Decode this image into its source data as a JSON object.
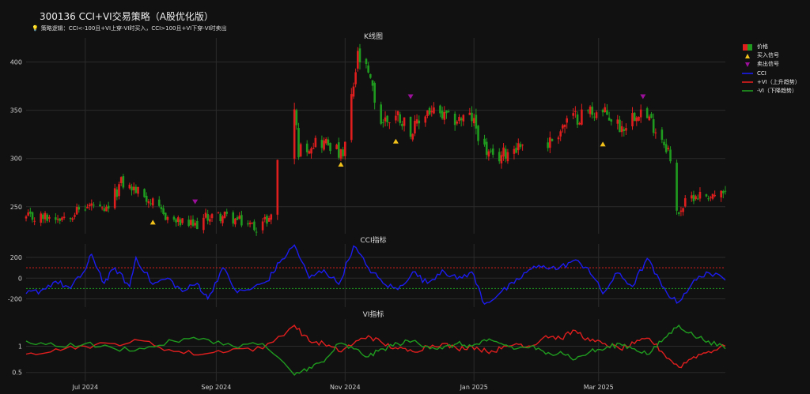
{
  "title": "300136 CCI+VI交易策略（A股优化版）",
  "subtitle": "策略逻辑：CCI<-100且+VI上穿-VI时买入，CCI>100且+VI下穿-VI时卖出",
  "colors": {
    "up": "#e01e1e",
    "down": "#1f9b1f",
    "buy": "#f2c21b",
    "sell": "#9b0f9b",
    "cci": "#1c1cf0",
    "vi_plus": "#e01e1e",
    "vi_minus": "#1f9b1f",
    "bg": "#111111",
    "grid": "#2b2b2b"
  },
  "panels": {
    "kline": "K线图",
    "cci": "CCI指标",
    "vi": "VI指标"
  },
  "legend": [
    {
      "label": "价格",
      "kind": "candle"
    },
    {
      "label": "买入信号",
      "kind": "buy"
    },
    {
      "label": "卖出信号",
      "kind": "sell"
    },
    {
      "label": "CCI",
      "kind": "cci"
    },
    {
      "label": "+VI（上升趋势）",
      "kind": "vi_plus"
    },
    {
      "label": "-VI（下降趋势）",
      "kind": "vi_minus"
    }
  ],
  "chart_data": [
    {
      "type": "candlestick",
      "title": "K线图",
      "x_start": "2024-06-03",
      "x_end": "2025-04-30",
      "x_ticks": [
        "Jul 2024",
        "Sep 2024",
        "Nov 2024",
        "Jan 2025",
        "Mar 2025"
      ],
      "y_ticks": [
        250,
        300,
        350,
        400
      ],
      "ylim": [
        222,
        425
      ],
      "close_keypoints": [
        [
          "2024-06-03",
          238
        ],
        [
          "2024-06-20",
          240
        ],
        [
          "2024-07-05",
          252
        ],
        [
          "2024-07-10",
          242
        ],
        [
          "2024-07-18",
          275
        ],
        [
          "2024-07-24",
          268
        ],
        [
          "2024-07-30",
          260
        ],
        [
          "2024-08-05",
          245
        ],
        [
          "2024-08-12",
          235
        ],
        [
          "2024-08-22",
          230
        ],
        [
          "2024-08-28",
          240
        ],
        [
          "2024-09-05",
          240
        ],
        [
          "2024-09-20",
          229
        ],
        [
          "2024-09-27",
          240
        ],
        [
          "2024-09-30",
          300
        ],
        [
          "2024-10-08",
          352
        ],
        [
          "2024-10-10",
          308
        ],
        [
          "2024-10-18",
          318
        ],
        [
          "2024-10-25",
          315
        ],
        [
          "2024-10-31",
          300
        ],
        [
          "2024-11-07",
          405
        ],
        [
          "2024-11-12",
          385
        ],
        [
          "2024-11-18",
          338
        ],
        [
          "2024-11-26",
          345
        ],
        [
          "2024-12-03",
          328
        ],
        [
          "2024-12-10",
          350
        ],
        [
          "2024-12-20",
          340
        ],
        [
          "2024-12-31",
          342
        ],
        [
          "2025-01-06",
          310
        ],
        [
          "2025-01-10",
          298
        ],
        [
          "2025-01-20",
          312
        ],
        [
          "2025-01-27",
          318
        ],
        [
          "2025-02-05",
          315
        ],
        [
          "2025-02-14",
          338
        ],
        [
          "2025-02-25",
          350
        ],
        [
          "2025-03-05",
          345
        ],
        [
          "2025-03-12",
          332
        ],
        [
          "2025-03-20",
          352
        ],
        [
          "2025-03-28",
          332
        ],
        [
          "2025-04-03",
          310
        ],
        [
          "2025-04-07",
          244
        ],
        [
          "2025-04-15",
          262
        ],
        [
          "2025-04-30",
          262
        ]
      ],
      "buy_signals": [
        [
          "2024-08-02",
          234
        ],
        [
          "2024-10-30",
          294
        ],
        [
          "2024-11-25",
          318
        ],
        [
          "2025-03-03",
          315
        ]
      ],
      "sell_signals": [
        [
          "2024-08-22",
          255
        ],
        [
          "2024-12-02",
          364
        ],
        [
          "2025-03-22",
          364
        ]
      ]
    },
    {
      "type": "line",
      "title": "CCI指标",
      "y_ticks": [
        -200,
        0,
        200
      ],
      "ylim": [
        -280,
        330
      ],
      "thresholds": [
        100,
        -100
      ],
      "series": [
        {
          "name": "CCI",
          "points": [
            [
              "2024-06-03",
              -150
            ],
            [
              "2024-06-10",
              -120
            ],
            [
              "2024-06-17",
              -30
            ],
            [
              "2024-06-24",
              -100
            ],
            [
              "2024-07-01",
              80
            ],
            [
              "2024-07-04",
              230
            ],
            [
              "2024-07-10",
              -50
            ],
            [
              "2024-07-15",
              100
            ],
            [
              "2024-07-22",
              -80
            ],
            [
              "2024-07-25",
              200
            ],
            [
              "2024-08-02",
              -60
            ],
            [
              "2024-08-09",
              0
            ],
            [
              "2024-08-16",
              -130
            ],
            [
              "2024-08-23",
              -50
            ],
            [
              "2024-08-28",
              -200
            ],
            [
              "2024-09-04",
              100
            ],
            [
              "2024-09-11",
              -140
            ],
            [
              "2024-09-18",
              -100
            ],
            [
              "2024-09-25",
              -30
            ],
            [
              "2024-10-01",
              150
            ],
            [
              "2024-10-08",
              320
            ],
            [
              "2024-10-15",
              0
            ],
            [
              "2024-10-22",
              80
            ],
            [
              "2024-10-29",
              -60
            ],
            [
              "2024-11-05",
              310
            ],
            [
              "2024-11-12",
              100
            ],
            [
              "2024-11-19",
              -50
            ],
            [
              "2024-11-26",
              -110
            ],
            [
              "2024-12-03",
              60
            ],
            [
              "2024-12-10",
              -50
            ],
            [
              "2024-12-17",
              80
            ],
            [
              "2024-12-24",
              -10
            ],
            [
              "2024-12-31",
              60
            ],
            [
              "2025-01-06",
              -250
            ],
            [
              "2025-01-13",
              -150
            ],
            [
              "2025-01-20",
              -50
            ],
            [
              "2025-01-27",
              80
            ],
            [
              "2025-02-03",
              120
            ],
            [
              "2025-02-10",
              90
            ],
            [
              "2025-02-17",
              170
            ],
            [
              "2025-02-24",
              100
            ],
            [
              "2025-03-03",
              -150
            ],
            [
              "2025-03-10",
              50
            ],
            [
              "2025-03-17",
              -80
            ],
            [
              "2025-03-24",
              190
            ],
            [
              "2025-03-31",
              -80
            ],
            [
              "2025-04-07",
              -240
            ],
            [
              "2025-04-14",
              -60
            ],
            [
              "2025-04-21",
              60
            ],
            [
              "2025-04-30",
              -20
            ]
          ]
        }
      ]
    },
    {
      "type": "line",
      "title": "VI指标",
      "y_ticks": [
        0.5,
        1
      ],
      "ylim": [
        0.33,
        1.52
      ],
      "series": [
        {
          "name": "+VI（上升趋势）",
          "points": [
            [
              "2024-06-03",
              0.85
            ],
            [
              "2024-06-17",
              0.95
            ],
            [
              "2024-07-01",
              1.0
            ],
            [
              "2024-07-15",
              1.05
            ],
            [
              "2024-07-29",
              1.1
            ],
            [
              "2024-08-12",
              0.9
            ],
            [
              "2024-08-26",
              0.85
            ],
            [
              "2024-09-09",
              0.95
            ],
            [
              "2024-09-23",
              0.95
            ],
            [
              "2024-10-08",
              1.4
            ],
            [
              "2024-10-15",
              1.1
            ],
            [
              "2024-10-22",
              1.05
            ],
            [
              "2024-10-29",
              0.9
            ],
            [
              "2024-11-05",
              1.05
            ],
            [
              "2024-11-12",
              1.2
            ],
            [
              "2024-11-19",
              1.05
            ],
            [
              "2024-11-26",
              0.95
            ],
            [
              "2024-12-03",
              0.9
            ],
            [
              "2024-12-10",
              1.0
            ],
            [
              "2024-12-17",
              1.05
            ],
            [
              "2024-12-24",
              0.95
            ],
            [
              "2024-12-31",
              1.0
            ],
            [
              "2025-01-07",
              0.9
            ],
            [
              "2025-01-14",
              0.95
            ],
            [
              "2025-01-21",
              1.05
            ],
            [
              "2025-01-28",
              1.0
            ],
            [
              "2025-02-04",
              1.2
            ],
            [
              "2025-02-11",
              1.15
            ],
            [
              "2025-02-18",
              1.3
            ],
            [
              "2025-02-25",
              1.1
            ],
            [
              "2025-03-04",
              1.05
            ],
            [
              "2025-03-11",
              0.95
            ],
            [
              "2025-03-18",
              1.05
            ],
            [
              "2025-03-25",
              1.15
            ],
            [
              "2025-04-01",
              0.85
            ],
            [
              "2025-04-08",
              0.6
            ],
            [
              "2025-04-15",
              0.8
            ],
            [
              "2025-04-22",
              0.9
            ],
            [
              "2025-04-30",
              1.0
            ]
          ]
        },
        {
          "name": "-VI（下降趋势）",
          "points": [
            [
              "2024-06-03",
              1.1
            ],
            [
              "2024-06-17",
              1.0
            ],
            [
              "2024-07-01",
              1.05
            ],
            [
              "2024-07-15",
              0.95
            ],
            [
              "2024-07-29",
              0.95
            ],
            [
              "2024-08-12",
              1.1
            ],
            [
              "2024-08-26",
              1.15
            ],
            [
              "2024-09-09",
              1.0
            ],
            [
              "2024-09-23",
              1.05
            ],
            [
              "2024-10-08",
              0.45
            ],
            [
              "2024-10-15",
              0.6
            ],
            [
              "2024-10-22",
              0.7
            ],
            [
              "2024-10-29",
              1.05
            ],
            [
              "2024-11-05",
              0.95
            ],
            [
              "2024-11-12",
              0.8
            ],
            [
              "2024-11-19",
              0.95
            ],
            [
              "2024-11-26",
              1.05
            ],
            [
              "2024-12-03",
              1.1
            ],
            [
              "2024-12-10",
              1.0
            ],
            [
              "2024-12-17",
              0.95
            ],
            [
              "2024-12-24",
              1.05
            ],
            [
              "2024-12-31",
              1.0
            ],
            [
              "2025-01-07",
              1.1
            ],
            [
              "2025-01-14",
              1.05
            ],
            [
              "2025-01-21",
              0.95
            ],
            [
              "2025-01-28",
              1.0
            ],
            [
              "2025-02-04",
              0.85
            ],
            [
              "2025-02-11",
              0.9
            ],
            [
              "2025-02-18",
              0.75
            ],
            [
              "2025-02-25",
              0.9
            ],
            [
              "2025-03-04",
              0.95
            ],
            [
              "2025-03-11",
              1.05
            ],
            [
              "2025-03-18",
              0.95
            ],
            [
              "2025-03-25",
              0.85
            ],
            [
              "2025-04-01",
              1.15
            ],
            [
              "2025-04-08",
              1.4
            ],
            [
              "2025-04-15",
              1.2
            ],
            [
              "2025-04-22",
              1.1
            ],
            [
              "2025-04-30",
              0.95
            ]
          ]
        }
      ]
    }
  ]
}
